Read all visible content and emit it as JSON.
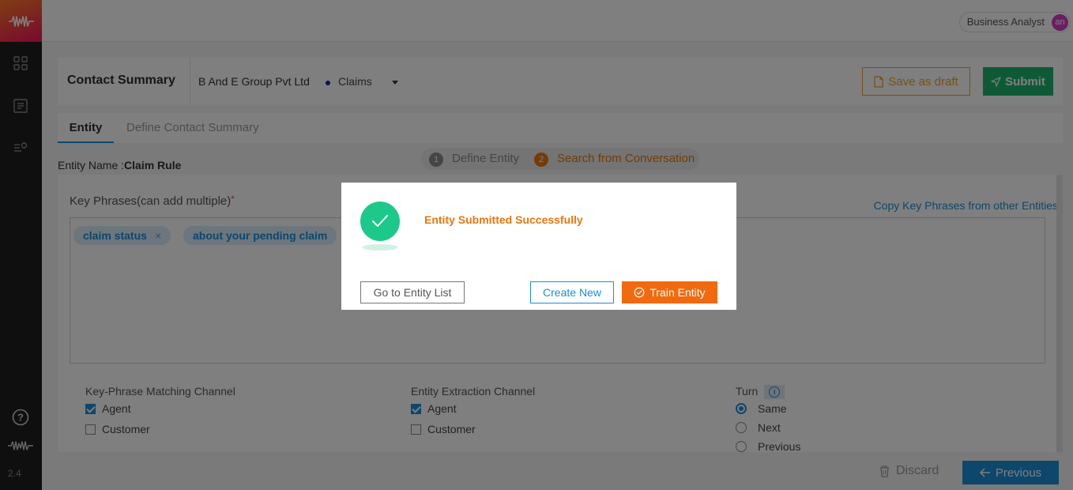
{
  "sidebar": {
    "logo_icon": "waveform-logo-icon",
    "nav_icons": [
      "grid-icon",
      "list-icon",
      "settings-list-icon"
    ],
    "bottom_icons": [
      "help-icon",
      "waveform-icon"
    ],
    "version": "2.4"
  },
  "header": {
    "role": "Business Analyst",
    "avatar_initials": "an"
  },
  "summary_card": {
    "title": "Contact Summary",
    "company": "B And E Group Pvt Ltd",
    "category": "Claims",
    "save_draft_label": "Save as draft",
    "submit_label": "Submit"
  },
  "tabs": [
    {
      "label": "Entity",
      "active": true
    },
    {
      "label": "Define Contact Summary",
      "active": false
    }
  ],
  "steps": [
    {
      "number": "1",
      "label": "Define Entity"
    },
    {
      "number": "2",
      "label": "Search from Conversation"
    }
  ],
  "entity": {
    "name_label": "Entity Name :",
    "name_value": "Claim Rule"
  },
  "key_phrases": {
    "label": "Key Phrases(can add multiple)",
    "required_mark": "*",
    "copy_link": "Copy Key Phrases from other Entities",
    "chips": [
      {
        "text": "claim status",
        "remove": "×"
      },
      {
        "text": "about your pending claim"
      }
    ]
  },
  "matching_channel": {
    "label": "Key-Phrase Matching Channel",
    "options": [
      {
        "label": "Agent",
        "checked": true
      },
      {
        "label": "Customer",
        "checked": false
      }
    ]
  },
  "extraction_channel": {
    "label": "Entity Extraction Channel",
    "options": [
      {
        "label": "Agent",
        "checked": true
      },
      {
        "label": "Customer",
        "checked": false
      }
    ]
  },
  "turn": {
    "label": "Turn",
    "info_icon": "info-icon",
    "info_glyph": "i",
    "options": [
      {
        "label": "Same",
        "selected": true
      },
      {
        "label": "Next",
        "selected": false
      },
      {
        "label": "Previous",
        "selected": false
      }
    ]
  },
  "footer": {
    "discard_label": "Discard",
    "previous_label": "Previous"
  },
  "modal": {
    "message": "Entity Submitted Successfully",
    "go_to_list_label": "Go to Entity List",
    "create_new_label": "Create New",
    "train_label": "Train Entity"
  },
  "colors": {
    "brand_gradient_start": "#ff7a2a",
    "brand_gradient_end": "#f0145a",
    "primary_blue": "#1a8fd9",
    "success_green": "#1db46c",
    "draft_orange": "#f0a12a",
    "train_orange": "#f26a10",
    "message_orange": "#e8760e"
  }
}
